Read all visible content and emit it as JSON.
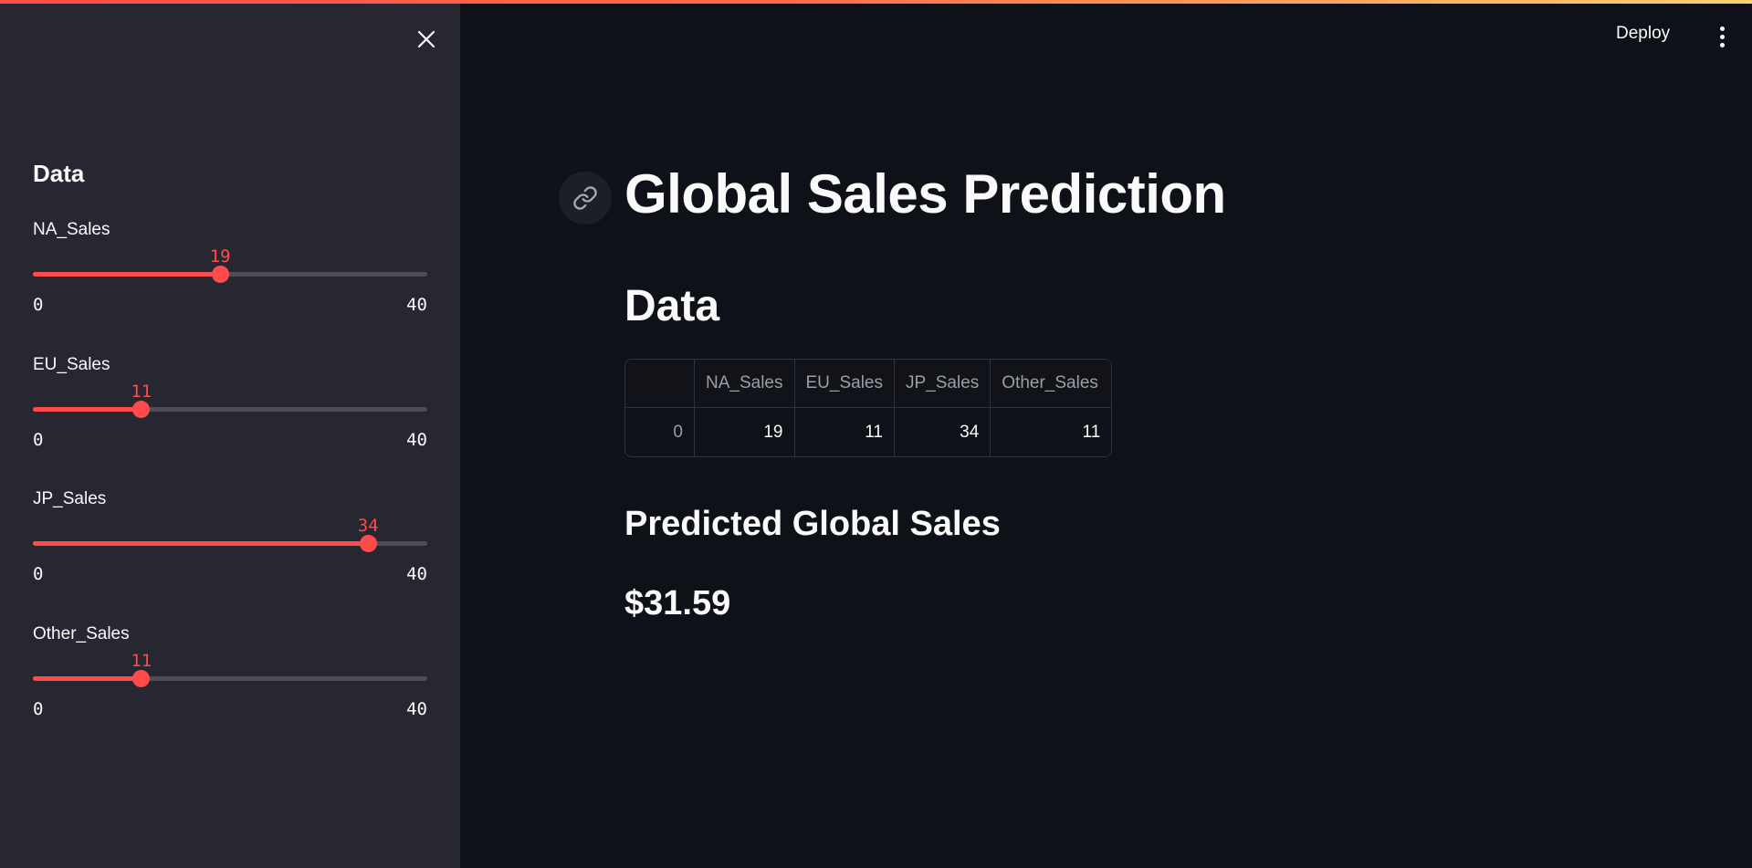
{
  "header": {
    "deploy_label": "Deploy"
  },
  "sidebar": {
    "heading": "Data",
    "sliders": [
      {
        "label": "NA_Sales",
        "value": 19,
        "min": 0,
        "max": 40
      },
      {
        "label": "EU_Sales",
        "value": 11,
        "min": 0,
        "max": 40
      },
      {
        "label": "JP_Sales",
        "value": 34,
        "min": 0,
        "max": 40
      },
      {
        "label": "Other_Sales",
        "value": 11,
        "min": 0,
        "max": 40
      }
    ]
  },
  "main": {
    "title": "Global Sales Prediction",
    "data_heading": "Data",
    "table": {
      "columns": [
        "",
        "NA_Sales",
        "EU_Sales",
        "JP_Sales",
        "Other_Sales"
      ],
      "rows": [
        [
          "0",
          "19",
          "11",
          "34",
          "11"
        ]
      ]
    },
    "prediction_heading": "Predicted Global Sales",
    "prediction_value": "$31.59"
  },
  "colors": {
    "accent": "#ff4b4b",
    "background": "#0e1117",
    "sidebar_background": "#262730",
    "track": "#4c4d57"
  },
  "icons": {
    "close": "close-icon",
    "anchor": "link-icon",
    "menu": "kebab-menu-icon"
  }
}
